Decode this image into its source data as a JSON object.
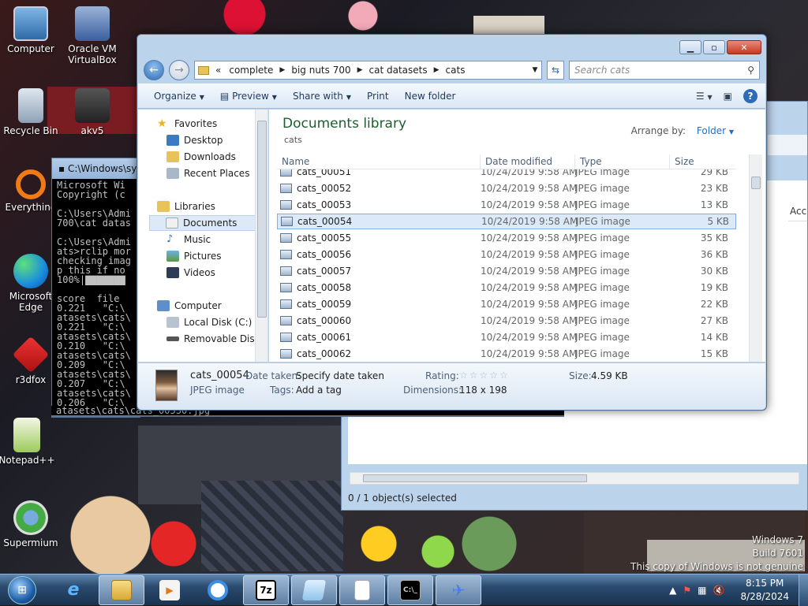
{
  "desktop": {
    "icons": [
      {
        "label": "Computer"
      },
      {
        "label": "Oracle VM VirtualBox"
      },
      {
        "label": "Recycle Bin"
      },
      {
        "label": "akv5"
      },
      {
        "label": "Everything"
      },
      {
        "label": "Microsoft Edge"
      },
      {
        "label": "r3dfox"
      },
      {
        "label": "Notepad++"
      },
      {
        "label": "Supermium"
      }
    ],
    "watermark": {
      "line1": "Windows 7",
      "line2": "Build 7601",
      "line3": "This copy of Windows is not genuine"
    }
  },
  "console": {
    "title": "C:\\Windows\\sy",
    "lines": [
      "Microsoft Wi",
      "Copyright (c",
      "",
      "C:\\Users\\Admi",
      "700\\cat datas",
      "",
      "C:\\Users\\Admi",
      "ats>rclip mor",
      "checking imag",
      "p this if no",
      "100%|▇▇▇▇▇▇▇",
      "",
      "score  file",
      "0.221   \"C:\\",
      "atasets\\cats\\",
      "0.221   \"C:\\",
      "atasets\\cats\\",
      "0.210   \"C:\\",
      "atasets\\cats\\",
      "0.209   \"C:\\",
      "atasets\\cats\\",
      "0.207   \"C:\\",
      "atasets\\cats\\",
      "0.206   \"C:\\"
    ],
    "bottom_line": "atasets\\cats\\cats_00530.jpg"
  },
  "explorer": {
    "breadcrumb": [
      "«",
      "complete",
      "big nuts 700",
      "cat datasets",
      "cats"
    ],
    "search_placeholder": "Search cats",
    "toolbar": {
      "organize": "Organize",
      "preview": "Preview",
      "share": "Share with",
      "print": "Print",
      "new_folder": "New folder"
    },
    "nav": {
      "favorites": "Favorites",
      "desktop": "Desktop",
      "downloads": "Downloads",
      "recent": "Recent Places",
      "libraries": "Libraries",
      "documents": "Documents",
      "music": "Music",
      "pictures": "Pictures",
      "videos": "Videos",
      "computer": "Computer",
      "local_disk": "Local Disk (C:)",
      "removable": "Removable Disk ("
    },
    "library": {
      "title": "Documents library",
      "subtitle": "cats",
      "arrange_label": "Arrange by:",
      "arrange_value": "Folder"
    },
    "columns": {
      "name": "Name",
      "date": "Date modified",
      "type": "Type",
      "size": "Size"
    },
    "files": [
      {
        "name": "cats_00051",
        "date": "10/24/2019 9:58 AM",
        "type": "JPEG image",
        "size": "29 KB"
      },
      {
        "name": "cats_00052",
        "date": "10/24/2019 9:58 AM",
        "type": "JPEG image",
        "size": "23 KB"
      },
      {
        "name": "cats_00053",
        "date": "10/24/2019 9:58 AM",
        "type": "JPEG image",
        "size": "13 KB"
      },
      {
        "name": "cats_00054",
        "date": "10/24/2019 9:58 AM",
        "type": "JPEG image",
        "size": "5 KB"
      },
      {
        "name": "cats_00055",
        "date": "10/24/2019 9:58 AM",
        "type": "JPEG image",
        "size": "35 KB"
      },
      {
        "name": "cats_00056",
        "date": "10/24/2019 9:58 AM",
        "type": "JPEG image",
        "size": "36 KB"
      },
      {
        "name": "cats_00057",
        "date": "10/24/2019 9:58 AM",
        "type": "JPEG image",
        "size": "30 KB"
      },
      {
        "name": "cats_00058",
        "date": "10/24/2019 9:58 AM",
        "type": "JPEG image",
        "size": "19 KB"
      },
      {
        "name": "cats_00059",
        "date": "10/24/2019 9:58 AM",
        "type": "JPEG image",
        "size": "22 KB"
      },
      {
        "name": "cats_00060",
        "date": "10/24/2019 9:58 AM",
        "type": "JPEG image",
        "size": "27 KB"
      },
      {
        "name": "cats_00061",
        "date": "10/24/2019 9:58 AM",
        "type": "JPEG image",
        "size": "14 KB"
      },
      {
        "name": "cats_00062",
        "date": "10/24/2019 9:58 AM",
        "type": "JPEG image",
        "size": "15 KB"
      }
    ],
    "selected_index": 3,
    "details": {
      "name": "cats_00054",
      "kind": "JPEG image",
      "date_label": "Date taken:",
      "date_value": "Specify date taken",
      "tags_label": "Tags:",
      "tags_value": "Add a tag",
      "rating_label": "Rating:",
      "dimensions_label": "Dimensions:",
      "dimensions_value": "118 x 198",
      "size_label": "Size:",
      "size_value": "4.59 KB"
    }
  },
  "second_window": {
    "status": "0 / 1 object(s) selected",
    "column_fragment": "Acc"
  },
  "taskbar": {
    "time": "8:15 PM",
    "date": "8/28/2024"
  }
}
